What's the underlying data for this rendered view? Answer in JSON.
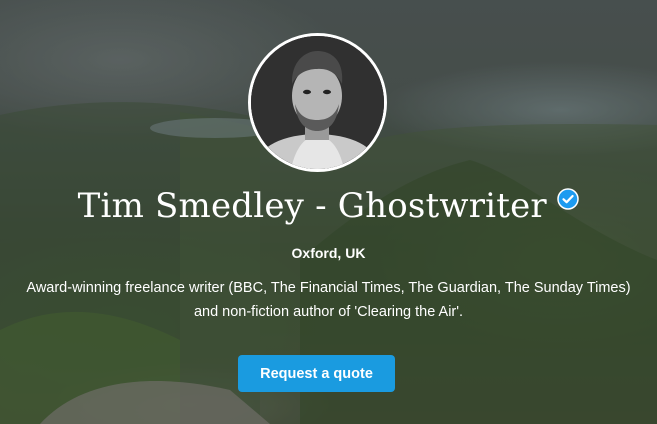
{
  "profile": {
    "name": "Tim Smedley - Ghostwriter",
    "verified_icon": "verified-check-icon",
    "location": "Oxford, UK",
    "bio": "Award-winning freelance writer (BBC, The Financial Times, The Guardian, The Sunday Times) and non-fiction author of 'Clearing the Air'."
  },
  "actions": {
    "request_quote_label": "Request a quote"
  },
  "colors": {
    "accent": "#1a9be0",
    "verified_badge": "#1d9bf0",
    "text": "#ffffff"
  }
}
